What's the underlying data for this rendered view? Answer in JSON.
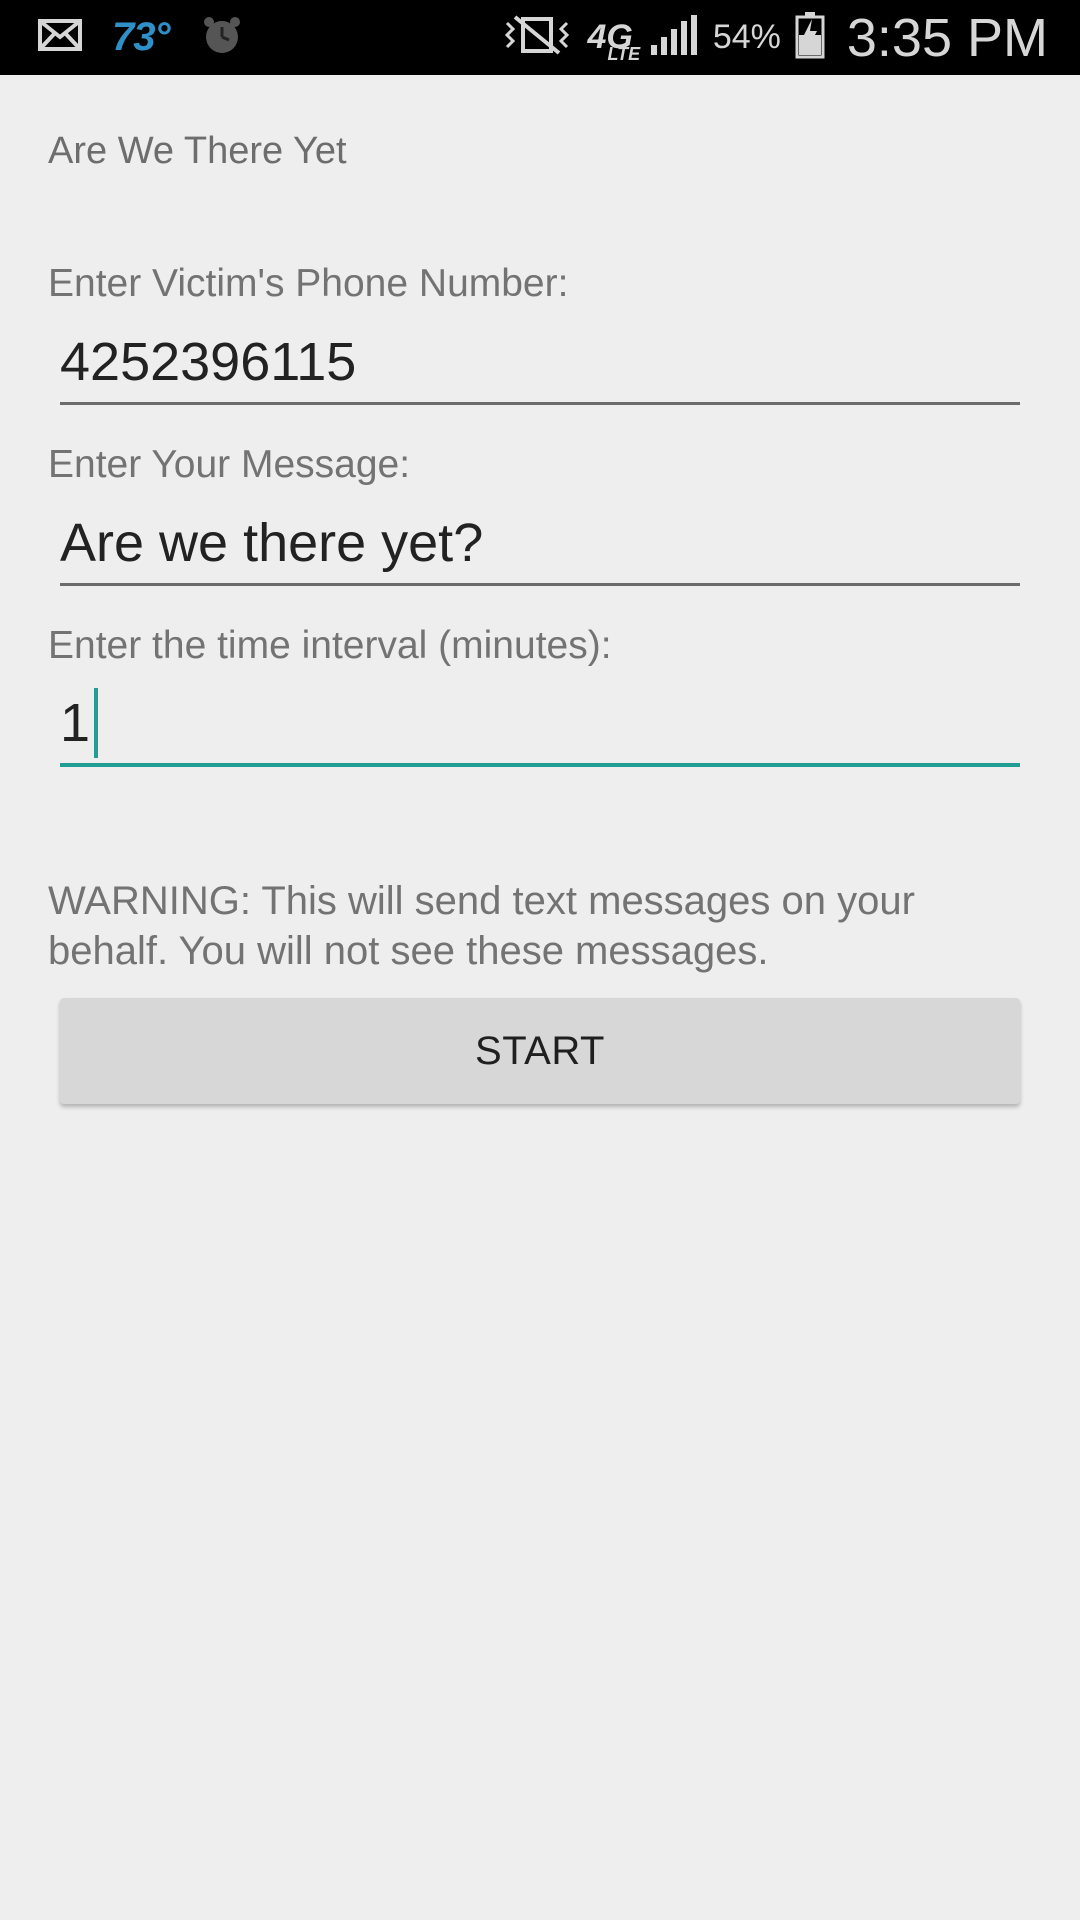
{
  "status_bar": {
    "temperature": "73°",
    "network_type": "4G",
    "network_sub": "LTE",
    "battery_percent": "54%",
    "time": "3:35 PM",
    "icons": [
      "mail-icon",
      "alarm-icon",
      "vibrate-icon",
      "signal-icon",
      "battery-charging-icon"
    ]
  },
  "app": {
    "title": "Are We There Yet"
  },
  "form": {
    "phone_label": "Enter Victim's Phone Number:",
    "phone_value": "4252396115",
    "message_label": "Enter Your Message:",
    "message_value": "Are we there yet?",
    "interval_label": "Enter the time interval (minutes):",
    "interval_value": "1"
  },
  "warning_text": "WARNING: This will send text messages on your behalf. You will not see these messages.",
  "start_button_label": "START",
  "colors": {
    "accent": "#219e93",
    "status_bar_bg": "#000000",
    "background": "#eeeeee",
    "temperature": "#2f8fc6"
  }
}
